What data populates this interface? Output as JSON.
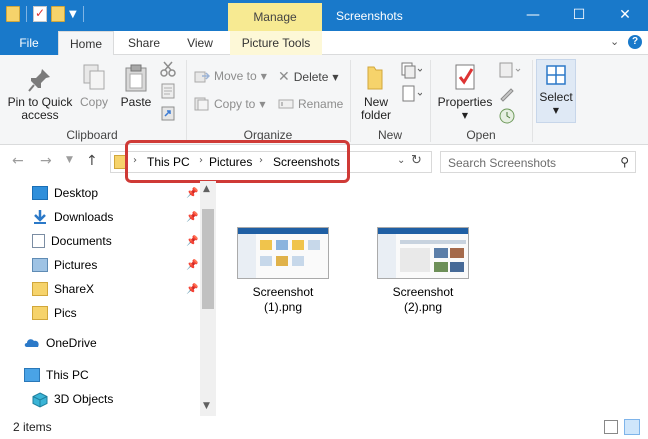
{
  "window": {
    "title": "Screenshots",
    "context_tab": "Manage",
    "minimize": "—",
    "maximize": "☐",
    "close": "✕"
  },
  "tabs": [
    "File",
    "Home",
    "Share",
    "View",
    "Picture Tools"
  ],
  "ribbon": {
    "clipboard": {
      "label": "Clipboard",
      "pin": "Pin to Quick access",
      "pin_line1": "Pin to Quick",
      "pin_line2": "access",
      "copy": "Copy",
      "paste": "Paste"
    },
    "organize": {
      "label": "Organize",
      "move_to": "Move to",
      "copy_to": "Copy to",
      "delete": "Delete",
      "rename": "Rename"
    },
    "new": {
      "label": "New",
      "new_folder_line1": "New",
      "new_folder_line2": "folder"
    },
    "open": {
      "label": "Open",
      "properties": "Properties"
    },
    "select": {
      "select": "Select"
    }
  },
  "address": {
    "crumbs": [
      "This PC",
      "Pictures",
      "Screenshots"
    ]
  },
  "search": {
    "placeholder": "Search Screenshots"
  },
  "nav": {
    "items": [
      {
        "label": "Desktop",
        "icon": "desktop-icon",
        "pinned": true
      },
      {
        "label": "Downloads",
        "icon": "downloads-icon",
        "pinned": true
      },
      {
        "label": "Documents",
        "icon": "documents-icon",
        "pinned": true
      },
      {
        "label": "Pictures",
        "icon": "pictures-icon",
        "pinned": true
      },
      {
        "label": "ShareX",
        "icon": "folder-icon",
        "pinned": true
      },
      {
        "label": "Pics",
        "icon": "folder-icon",
        "pinned": false
      },
      {
        "label": "OneDrive",
        "icon": "onedrive-icon",
        "pinned": false
      },
      {
        "label": "This PC",
        "icon": "this-pc-icon",
        "pinned": false
      },
      {
        "label": "3D Objects",
        "icon": "3d-objects-icon",
        "pinned": false
      }
    ]
  },
  "files": [
    {
      "name_line1": "Screenshot",
      "name_line2": "(1).png"
    },
    {
      "name_line1": "Screenshot",
      "name_line2": "(2).png"
    }
  ],
  "status": {
    "items": "2 items"
  },
  "colors": {
    "titlebar": "#1979ca",
    "manage_tab": "#f7ea92",
    "highlight": "#cf3a36"
  }
}
